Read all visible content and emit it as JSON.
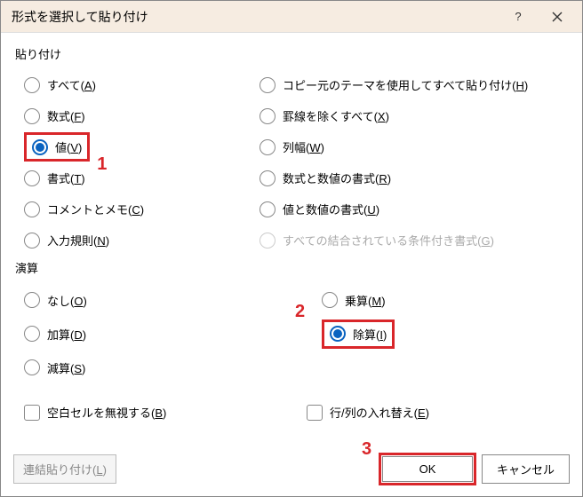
{
  "titlebar": {
    "title": "形式を選択して貼り付け",
    "help": "?"
  },
  "section_paste": "貼り付け",
  "paste_left": {
    "all": {
      "label": "すべて(",
      "u": "A",
      "suf": ")"
    },
    "formulas": {
      "label": "数式(",
      "u": "F",
      "suf": ")"
    },
    "values": {
      "label": "値(",
      "u": "V",
      "suf": ")"
    },
    "formats": {
      "label": "書式(",
      "u": "T",
      "suf": ")"
    },
    "comments": {
      "label": "コメントとメモ(",
      "u": "C",
      "suf": ")"
    },
    "validation": {
      "label": "入力規則(",
      "u": "N",
      "suf": ")"
    }
  },
  "paste_right": {
    "theme": {
      "label": "コピー元のテーマを使用してすべて貼り付け(",
      "u": "H",
      "suf": ")"
    },
    "noborder": {
      "label": "罫線を除くすべて(",
      "u": "X",
      "suf": ")"
    },
    "colwidth": {
      "label": "列幅(",
      "u": "W",
      "suf": ")"
    },
    "formnum": {
      "label": "数式と数値の書式(",
      "u": "R",
      "suf": ")"
    },
    "valnum": {
      "label": "値と数値の書式(",
      "u": "U",
      "suf": ")"
    },
    "condfmt": {
      "label": "すべての結合されている条件付き書式(",
      "u": "G",
      "suf": ")"
    }
  },
  "section_op": "演算",
  "op_left": {
    "none": {
      "label": "なし(",
      "u": "O",
      "suf": ")"
    },
    "add": {
      "label": "加算(",
      "u": "D",
      "suf": ")"
    },
    "sub": {
      "label": "減算(",
      "u": "S",
      "suf": ")"
    }
  },
  "op_right": {
    "mul": {
      "label": "乗算(",
      "u": "M",
      "suf": ")"
    },
    "div": {
      "label": "除算(",
      "u": "I",
      "suf": ")"
    }
  },
  "checks": {
    "skip": {
      "label": "空白セルを無視する(",
      "u": "B",
      "suf": ")"
    },
    "transpose": {
      "label": "行/列の入れ替え(",
      "u": "E",
      "suf": ")"
    }
  },
  "footer": {
    "pastelink": {
      "label": "連結貼り付け(",
      "u": "L",
      "suf": ")"
    },
    "ok": "OK",
    "cancel": "キャンセル"
  },
  "annotations": {
    "one": "1",
    "two": "2",
    "three": "3"
  }
}
